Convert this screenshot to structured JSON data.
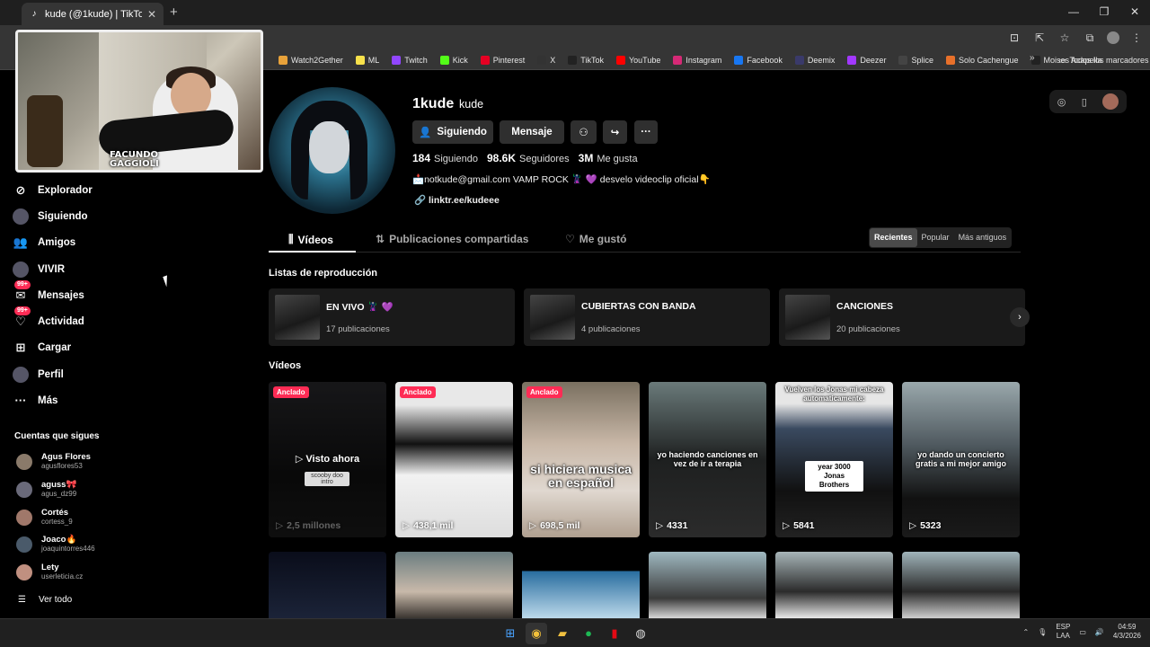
{
  "browser": {
    "tab_title": "kude (@1kude) | TikTok",
    "new_tab": "+",
    "win_minimize": "—",
    "win_restore": "❐",
    "win_close": "✕",
    "bookmarks": [
      {
        "label": "Watch2Gether",
        "color": "#e8a23a"
      },
      {
        "label": "ML",
        "color": "#f7e14b"
      },
      {
        "label": "Twitch",
        "color": "#9146ff"
      },
      {
        "label": "Kick",
        "color": "#53fc18"
      },
      {
        "label": "Pinterest",
        "color": "#e60023"
      },
      {
        "label": "X",
        "color": "#333333"
      },
      {
        "label": "TikTok",
        "color": "#222222"
      },
      {
        "label": "YouTube",
        "color": "#ff0000"
      },
      {
        "label": "Instagram",
        "color": "#d62976"
      },
      {
        "label": "Facebook",
        "color": "#1877f2"
      },
      {
        "label": "Deemix",
        "color": "#3a3a6a"
      },
      {
        "label": "Deezer",
        "color": "#a238ff"
      },
      {
        "label": "Splice",
        "color": "#444444"
      },
      {
        "label": "Solo Cachengue",
        "color": "#e8702a"
      },
      {
        "label": "Moises Acapella",
        "color": "#222222"
      }
    ],
    "bookmarks_more": "»",
    "all_bookmarks": "Todos los marcadores"
  },
  "webcam": {
    "label_line1": "FACUNDO",
    "label_line2": "GAGGIOLI"
  },
  "sidebar": {
    "items": [
      {
        "label": "Explorador",
        "icon": "compass-icon",
        "glyph": "⊘"
      },
      {
        "label": "Siguiendo",
        "icon": "avatar-icon",
        "glyph": ""
      },
      {
        "label": "Amigos",
        "icon": "friends-icon",
        "glyph": "👥"
      },
      {
        "label": "VIVIR",
        "icon": "live-icon",
        "glyph": ""
      },
      {
        "label": "Mensajes",
        "icon": "messages-icon",
        "glyph": "✉",
        "badge": "99+"
      },
      {
        "label": "Actividad",
        "icon": "activity-icon",
        "glyph": "♡",
        "badge": "99+"
      },
      {
        "label": "Cargar",
        "icon": "upload-icon",
        "glyph": "⊞"
      },
      {
        "label": "Perfil",
        "icon": "profile-icon",
        "glyph": ""
      },
      {
        "label": "Más",
        "icon": "more-icon",
        "glyph": "···"
      }
    ],
    "following_title": "Cuentas que sigues",
    "following": [
      {
        "name": "Agus Flores",
        "user": "agusflores53",
        "color": "#8a7a6a"
      },
      {
        "name": "aguss🎀",
        "user": "agus_dz99",
        "color": "#6a6a7a"
      },
      {
        "name": "Cortés",
        "user": "cortess_9",
        "color": "#a0786a"
      },
      {
        "name": "Joaco🔥",
        "user": "joaquintorres446",
        "color": "#4a5a6a"
      },
      {
        "name": "Lety",
        "user": "userleticia.cz",
        "color": "#c09080"
      }
    ],
    "see_all": "Ver todo"
  },
  "profile": {
    "username": "1kude",
    "nickname": "kude",
    "btn_following": "Siguiendo",
    "btn_message": "Mensaje",
    "following_count": "184",
    "following_label": "Siguiendo",
    "followers_count": "98.6K",
    "followers_label": "Seguidores",
    "likes_count": "3M",
    "likes_label": "Me gusta",
    "bio": "📩notkude@gmail.com VAMP ROCK 🦹 💜 desvelo videoclip oficial👇",
    "link": "linktr.ee/kudeee"
  },
  "tabs": {
    "videos": "Vídeos",
    "reposts": "Publicaciones compartidas",
    "liked": "Me gustó",
    "sort": [
      "Recientes",
      "Popular",
      "Más antiguos"
    ],
    "sort_active": "Recientes"
  },
  "playlists": {
    "title": "Listas de reproducción",
    "items": [
      {
        "title": "EN VIVO 🦹 💜",
        "count": "17 publicaciones"
      },
      {
        "title": "CUBIERTAS CON BANDA",
        "count": "4 publicaciones"
      },
      {
        "title": "CANCIONES",
        "count": "20 publicaciones"
      }
    ],
    "next": "›"
  },
  "videos": {
    "title": "Vídeos",
    "pinned_label": "Anclado",
    "watched_label": "Visto ahora",
    "items": [
      {
        "views": "2,5 millones",
        "pinned": true,
        "caption": "",
        "boxcap": "scooby doo intro"
      },
      {
        "views": "438,1 mil",
        "pinned": true,
        "caption": "",
        "boxcap": ""
      },
      {
        "views": "698,5 mil",
        "pinned": true,
        "caption": "si hiciera musica en español",
        "boxcap": ""
      },
      {
        "views": "4331",
        "pinned": false,
        "caption": "yo haciendo canciones en vez de ir a terapia",
        "boxcap": ""
      },
      {
        "views": "5841",
        "pinned": false,
        "caption": "Vuelven los Jonas mi cabeza automaticamente:",
        "boxcap": "year 3000 Jonas Brothers"
      },
      {
        "views": "5323",
        "pinned": false,
        "caption": "yo dando un concierto gratis a mi mejor amigo",
        "boxcap": ""
      }
    ]
  },
  "taskbar": {
    "lang_line1": "ESP",
    "lang_line2": "LAA",
    "time": "04:59",
    "date": "4/3/2026"
  }
}
